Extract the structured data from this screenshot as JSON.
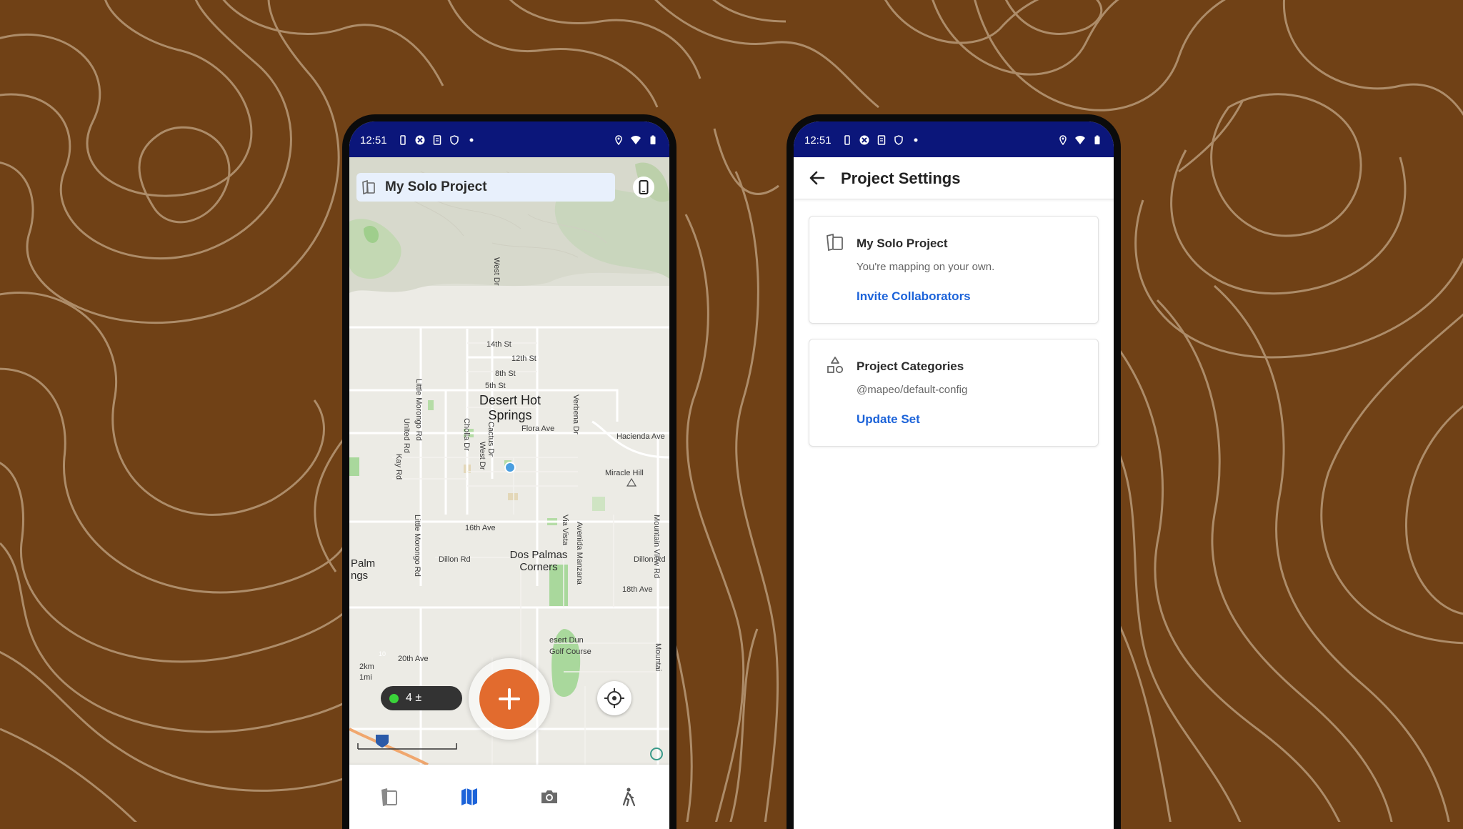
{
  "colors": {
    "background": "#704116",
    "topo_line": "#b89a78",
    "status_bar": "#0b167a",
    "accent_orange": "#e26b2e",
    "link_blue": "#1c63d9",
    "gps_green": "#3ad33a"
  },
  "left_phone": {
    "status": {
      "time": "12:51"
    },
    "project_bar": {
      "title": "My Solo Project",
      "icon": "cards-icon"
    },
    "map": {
      "labels": {
        "west_dr_top": "West Dr",
        "s14": "14th St",
        "s12": "12th St",
        "s8": "8th St",
        "s5": "5th St",
        "city_line1": "Desert Hot",
        "city_line2": "Springs",
        "verbena": "Verbena Dr",
        "flora": "Flora Ave",
        "little_morongo_top": "Little Morongo Rd",
        "united": "United Rd",
        "kay": "Kay Rd",
        "cholla": "Cholla Dr",
        "cactus": "Cactus Dr",
        "west_dr": "West Dr",
        "hacienda": "Hacienda Ave",
        "miracle": "Miracle Hill",
        "little_morongo_bottom": "Little Morongo Rd",
        "s16": "16th Ave",
        "via_vista": "Via Vista",
        "manzana": "Avenida Manzana",
        "mountain_view": "Mountain View Rd",
        "dillon_left": "Dillon Rd",
        "dos_palmas_1": "Dos Palmas",
        "dos_palmas_2": "Corners",
        "dillon_right": "Dillon Rd",
        "palm_1": "Palm",
        "palm_2": "ngs",
        "ave18": "18th Ave",
        "ave20": "20th Ave",
        "golf_1": "esert Dun",
        "golf_2": "Golf Course",
        "mountain_bottom": "Mountai",
        "interstate": "10",
        "scale_km": "2km",
        "scale_mi": "1mi"
      }
    },
    "gps": {
      "accuracy": "4 ±"
    },
    "add_button": {
      "symbol": "+"
    },
    "nav": [
      "cards-icon",
      "map-icon",
      "camera-icon",
      "hiker-icon"
    ]
  },
  "right_phone": {
    "status": {
      "time": "12:51"
    },
    "header": {
      "title": "Project Settings"
    },
    "project_card": {
      "title": "My Solo Project",
      "subtitle": "You're mapping on your own.",
      "link": "Invite Collaborators"
    },
    "categories_card": {
      "title": "Project Categories",
      "subtitle": "@mapeo/default-config",
      "link": "Update Set"
    }
  }
}
